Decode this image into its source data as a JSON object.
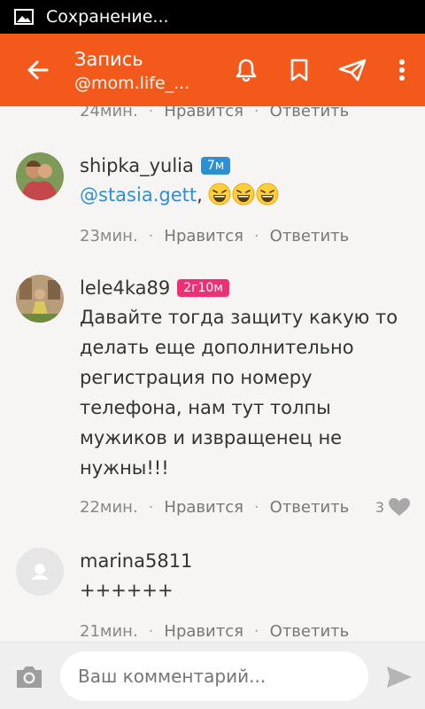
{
  "status_bar": {
    "text": "Сохранение..."
  },
  "app_bar": {
    "title": "Запись",
    "subtitle": "@mom.life_..."
  },
  "comments": [
    {
      "time": "24мин.",
      "like_label": "Нравится",
      "reply_label": "Ответить"
    },
    {
      "username": "shipka_yulia",
      "badge": "7м",
      "badge_color": "#2f8fd3",
      "mention": "@stasia.gett",
      "text_after": ",",
      "time": "23мин.",
      "like_label": "Нравится",
      "reply_label": "Ответить"
    },
    {
      "username": "lele4ka89",
      "badge": "2г10м",
      "badge_color": "#ee2f76",
      "text": "Давайте тогда защиту какую то делать еще дополнительно регистрация по номеру телефона, нам тут толпы мужиков и извращенец не нужны!!!",
      "time": "22мин.",
      "like_label": "Нравится",
      "reply_label": "Ответить",
      "like_count": "3"
    },
    {
      "username": "marina5811",
      "text": "++++++",
      "time": "21мин.",
      "like_label": "Нравится",
      "reply_label": "Ответить"
    }
  ],
  "composer": {
    "placeholder": "Ваш комментарий..."
  },
  "colors": {
    "accent": "#f4591c",
    "mention": "#2f8fd3"
  }
}
